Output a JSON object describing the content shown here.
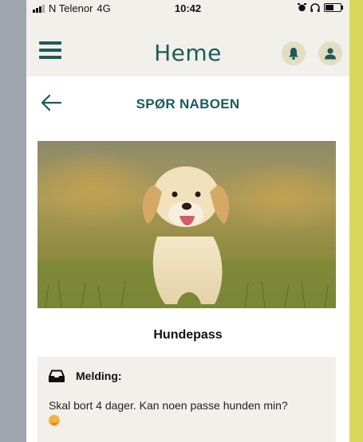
{
  "status_bar": {
    "carrier": "N Telenor",
    "network": "4G",
    "time": "10:42"
  },
  "header": {
    "logo_text": "Heme",
    "menu_icon": "hamburger-icon",
    "notification_icon": "bell-icon",
    "profile_icon": "user-icon"
  },
  "page": {
    "title": "SPØR NABOEN",
    "back_icon": "arrow-left-icon"
  },
  "post": {
    "image_subject": "puppy",
    "title": "Hundepass",
    "message_label": "Melding:",
    "message_text": "Skal bort 4 dager. Kan noen passe hunden min?",
    "message_icon": "inbox-icon"
  },
  "colors": {
    "brand": "#1e5a5a",
    "header_bg": "#f1f0ea",
    "icon_button_bg": "#e3ddc4"
  }
}
